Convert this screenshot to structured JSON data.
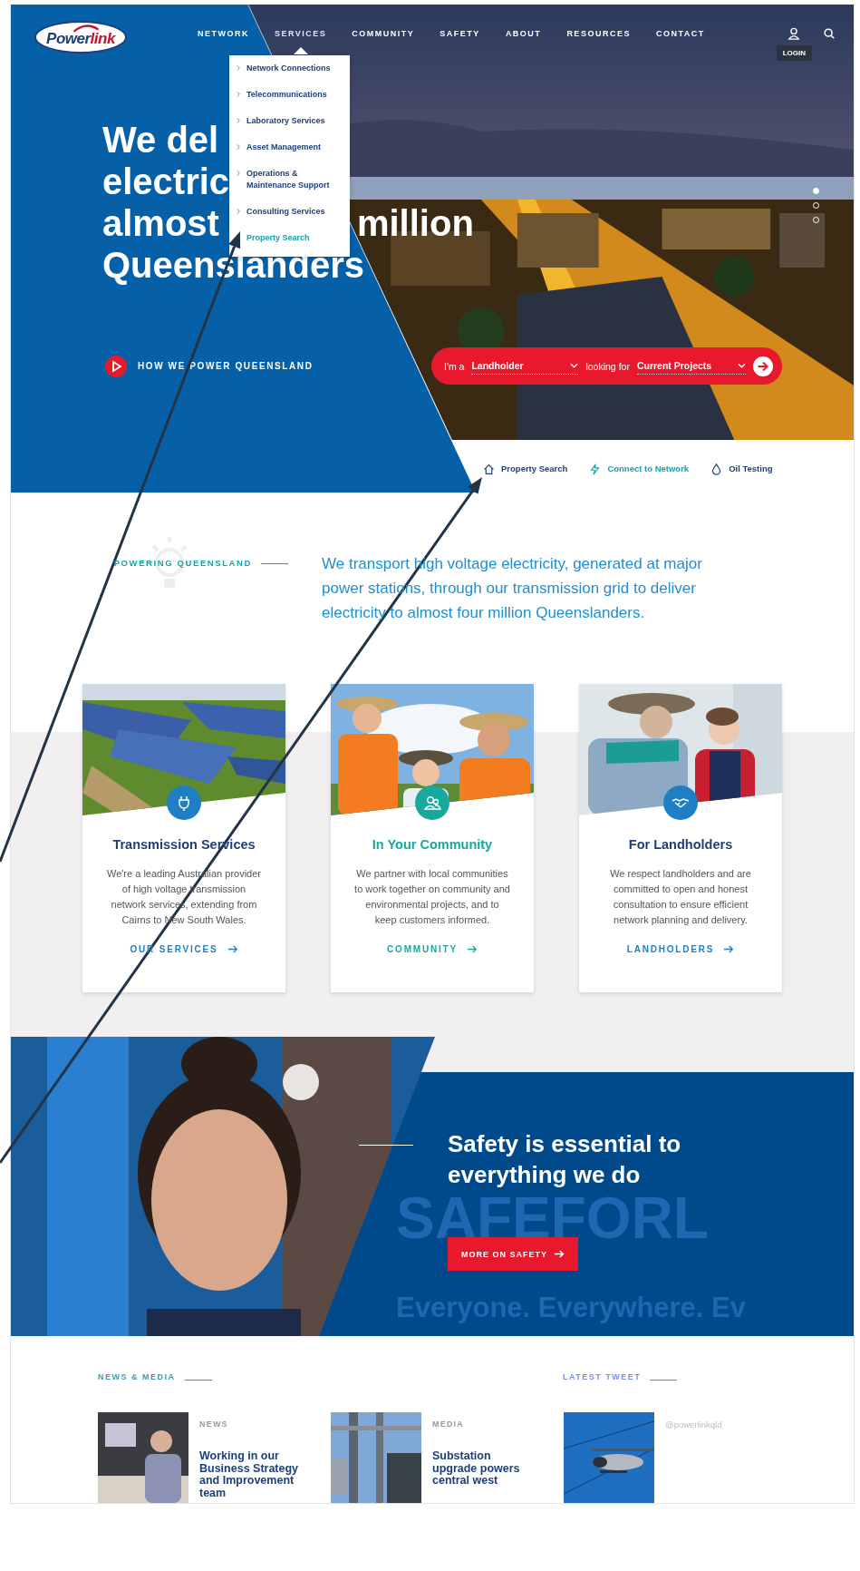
{
  "logo": {
    "part_1": "Power",
    "part_2": "link"
  },
  "nav": [
    {
      "label": "NETWORK",
      "selected": false
    },
    {
      "label": "SERVICES",
      "selected": true
    },
    {
      "label": "COMMUNITY",
      "selected": false
    },
    {
      "label": "SAFETY",
      "selected": false
    },
    {
      "label": "ABOUT",
      "selected": false
    },
    {
      "label": "RESOURCES",
      "selected": false
    },
    {
      "label": "CONTACT",
      "selected": false
    }
  ],
  "login_label": "LOGIN",
  "services_menu": [
    {
      "label": "Network Connections",
      "selected": false
    },
    {
      "label": "Telecommunications",
      "selected": false
    },
    {
      "label": "Laboratory Services",
      "selected": false
    },
    {
      "label": "Asset Management",
      "selected": false
    },
    {
      "label": "Operations & Maintenance Support",
      "selected": false
    },
    {
      "label": "Consulting Services",
      "selected": false
    },
    {
      "label": "Property Search",
      "selected": true
    }
  ],
  "hero": {
    "title_lines": [
      [
        "We del"
      ],
      [
        "electric"
      ],
      [
        "almost",
        "million"
      ],
      [
        "Queenslanders"
      ]
    ],
    "video_link": "HOW WE POWER QUEENSLAND",
    "slides": [
      {
        "selected": true
      },
      {
        "selected": false
      },
      {
        "selected": false
      }
    ]
  },
  "finder": {
    "label_1": "I'm a",
    "role": "Landholder",
    "label_2": "looking for",
    "topic": "Current Projects"
  },
  "quick_links": [
    {
      "label": "Property Search",
      "color": "#1d3f7a"
    },
    {
      "label": "Connect to Network",
      "color": "#17a2a8"
    },
    {
      "label": "Oil Testing",
      "color": "#1d3f7a"
    }
  ],
  "intro": {
    "label": "POWERING QUEENSLAND",
    "text": "We transport high voltage electricity, generated at major power stations, through our transmission grid to deliver electricity to almost four million Queenslanders."
  },
  "cards": [
    {
      "title": "Transmission Services",
      "text": "We're a leading Australian provider of high voltage transmission network services, extending from Cairns to New South Wales.",
      "link": "OUR SERVICES",
      "color": "#1f7fc4",
      "accent": false
    },
    {
      "title": "In Your Community",
      "text": "We partner with local communities to work together on community and environmental projects, and to keep customers informed.",
      "link": "COMMUNITY",
      "color": "#19a89e",
      "accent": true
    },
    {
      "title": "For Landholders",
      "text": "We respect landholders and are committed to open and honest consultation to ensure efficient network planning and delivery.",
      "link": "LANDHOLDERS",
      "color": "#1f7fc4",
      "accent": false
    }
  ],
  "safety": {
    "title": "Safety is essential to everything we do",
    "button": "MORE ON SAFETY",
    "backdrop_1": "SAFEFORL",
    "backdrop_2": "Everyone. Everywhere. Ev"
  },
  "news": {
    "label": "NEWS & MEDIA",
    "items": [
      {
        "category": "NEWS",
        "title": "Working in our Business Strategy and Improvement team"
      },
      {
        "category": "MEDIA",
        "title": "Substation upgrade powers central west"
      }
    ]
  },
  "tweet": {
    "label": "LATEST TWEET",
    "handle": "@powerlinkqld"
  }
}
